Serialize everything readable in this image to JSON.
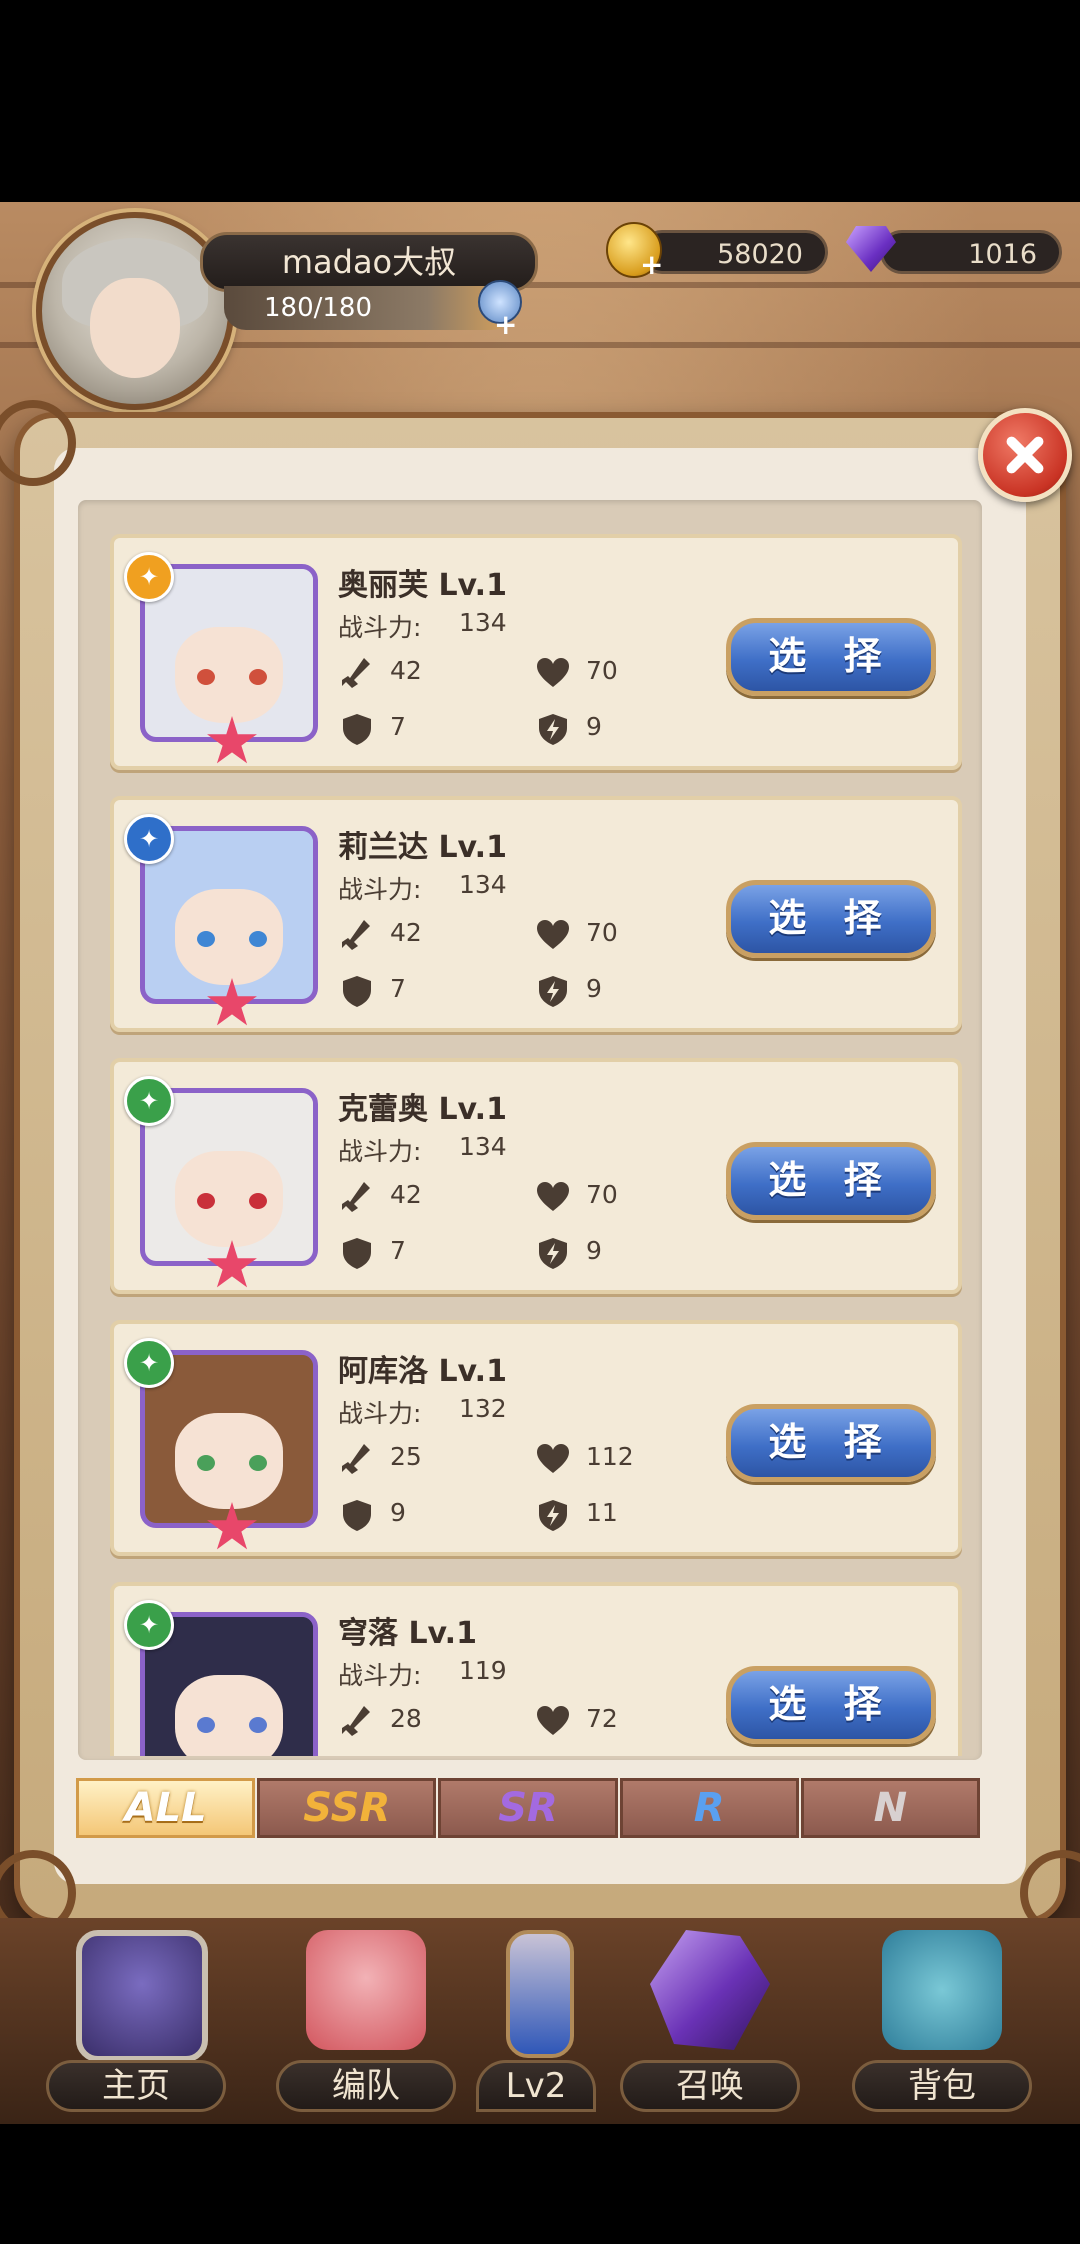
{
  "player": {
    "name": "madao大叔",
    "stamina": "180/180",
    "gold": "58020",
    "gems": "1016"
  },
  "select_label": "选 择",
  "power_label": "战斗力:",
  "characters": [
    {
      "name": "奥丽芙 Lv.1",
      "power": "134",
      "atk": "42",
      "hp": "70",
      "def": "7",
      "spd": "9",
      "element": "light-element-icon",
      "element_color": "#f0a020",
      "hair": "#e4e6ee",
      "eye": "#d0503c"
    },
    {
      "name": "莉兰达 Lv.1",
      "power": "134",
      "atk": "42",
      "hp": "70",
      "def": "7",
      "spd": "9",
      "element": "water-element-icon",
      "element_color": "#2f6fc9",
      "hair": "#b9cff2",
      "eye": "#3f86d4"
    },
    {
      "name": "克蕾奥 Lv.1",
      "power": "134",
      "atk": "42",
      "hp": "70",
      "def": "7",
      "spd": "9",
      "element": "wind-element-icon",
      "element_color": "#3aa04a",
      "hair": "#eceae8",
      "eye": "#c9303a"
    },
    {
      "name": "阿库洛 Lv.1",
      "power": "132",
      "atk": "25",
      "hp": "112",
      "def": "9",
      "spd": "11",
      "element": "wind-element-icon",
      "element_color": "#3aa04a",
      "hair": "#8a5a3a",
      "eye": "#4aa05a"
    },
    {
      "name": "穹落 Lv.1",
      "power": "119",
      "atk": "28",
      "hp": "72",
      "def": "",
      "spd": "",
      "element": "wind-element-icon",
      "element_color": "#3aa04a",
      "hair": "#2f2d4a",
      "eye": "#5a7ad0"
    }
  ],
  "filter_tabs": [
    {
      "label": "ALL",
      "color": "#ffffff"
    },
    {
      "label": "SSR",
      "color": "#f2b23a"
    },
    {
      "label": "SR",
      "color": "#a36ae0"
    },
    {
      "label": "R",
      "color": "#5aa0f0"
    },
    {
      "label": "N",
      "color": "#d8d0d0"
    }
  ],
  "nav": {
    "home": "主页",
    "team": "编队",
    "level": "Lv2",
    "summon": "召唤",
    "bag": "背包"
  }
}
